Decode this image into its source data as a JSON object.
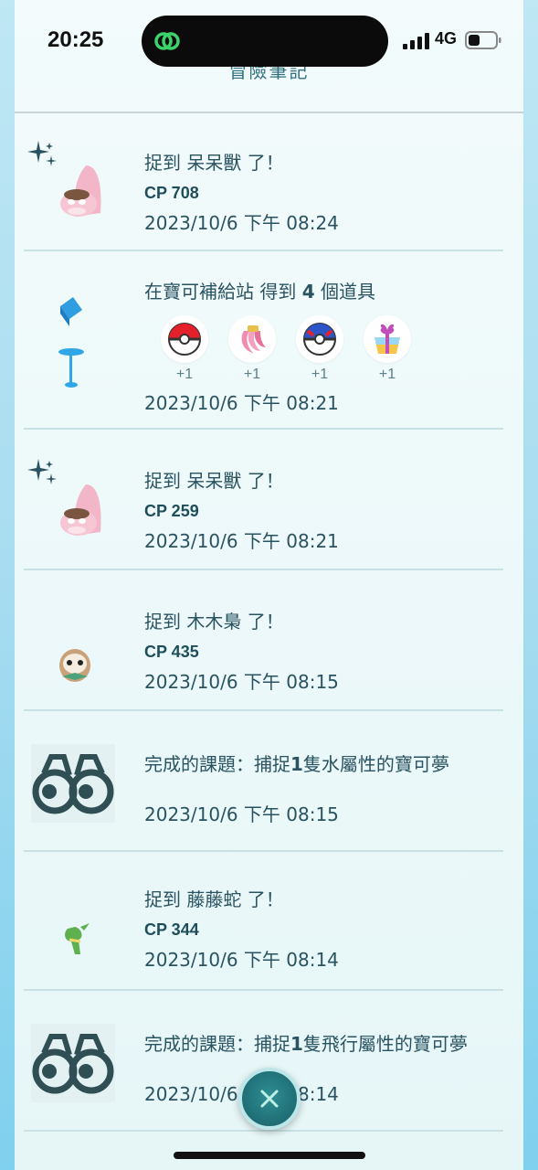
{
  "status_bar": {
    "time": "20:25",
    "network": "4G"
  },
  "header": {
    "title": "冒險筆記"
  },
  "entries": [
    {
      "prefix": "捉到 ",
      "subject": "呆呆獸",
      "suffix": " 了！",
      "cp": "CP 708",
      "date": "2023/10/6 下午 08:24"
    },
    {
      "prefix": "在寶可補給站  得到 ",
      "count": "4",
      "suffix": " 個道具",
      "date": "2023/10/6 下午 08:21",
      "items": [
        {
          "name": "poke-ball",
          "count": "+1"
        },
        {
          "name": "nanab-berry",
          "count": "+1"
        },
        {
          "name": "great-ball",
          "count": "+1"
        },
        {
          "name": "gift",
          "count": "+1"
        }
      ]
    },
    {
      "prefix": "捉到 ",
      "subject": "呆呆獸",
      "suffix": " 了！",
      "cp": "CP 259",
      "date": "2023/10/6 下午 08:21"
    },
    {
      "prefix": "捉到 ",
      "subject": "木木梟",
      "suffix": " 了！",
      "cp": "CP 435",
      "date": "2023/10/6 下午 08:15"
    },
    {
      "prefix": "完成的課題：捕捉",
      "count": "1",
      "suffix": "隻水屬性的寶可夢",
      "date": "2023/10/6 下午 08:15"
    },
    {
      "prefix": "捉到 ",
      "subject": "藤藤蛇",
      "suffix": " 了！",
      "cp": "CP 344",
      "date": "2023/10/6 下午 08:14"
    },
    {
      "prefix": "完成的課題：捕捉",
      "count": "1",
      "suffix": "隻飛行屬性的寶可夢",
      "date": "2023/10/6 下午 08:14"
    }
  ],
  "colors": {
    "accent": "#1f6d74",
    "text": "#2a5361",
    "panel": "#eef9fa"
  }
}
